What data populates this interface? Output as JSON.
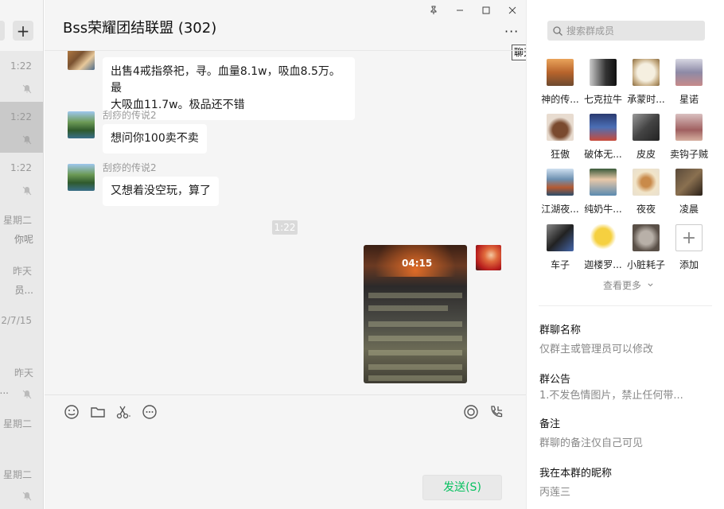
{
  "chat_list": {
    "items": [
      {
        "time": "1:22",
        "muted": true,
        "preview": ""
      },
      {
        "time": "1:22",
        "muted": true,
        "preview": "",
        "selected": true
      },
      {
        "time": "1:22",
        "muted": true,
        "preview": ""
      },
      {
        "time": "星期二",
        "muted": false,
        "preview": "你呢"
      },
      {
        "time": "昨天",
        "muted": false,
        "preview": "员..."
      },
      {
        "time": "2/7/15",
        "muted": false,
        "preview": ""
      },
      {
        "time": "昨天",
        "muted": true,
        "preview": "..."
      },
      {
        "time": "星期二",
        "muted": false,
        "preview": ""
      },
      {
        "time": "星期二",
        "muted": true,
        "preview": ""
      }
    ]
  },
  "chat": {
    "title": "Bss荣耀团结联盟 (302)",
    "tooltip": "聊天",
    "messages": [
      {
        "sender": "",
        "text_line1": "出售4戒指祭祀，寻。血量8.1w，吸血8.5万。最",
        "text_line2": "大吸血11.7w。极品还不错"
      },
      {
        "sender": "刮痧的传说2",
        "text": "想问你100卖不卖"
      },
      {
        "sender": "刮痧的传说2",
        "text": "又想着没空玩，算了"
      }
    ],
    "time_divider": "1:22",
    "image_caption": "04:15",
    "send_button": "发送(S)"
  },
  "panel": {
    "search_placeholder": "搜索群成员",
    "members": [
      {
        "name": "神的传..."
      },
      {
        "name": "七克拉牛"
      },
      {
        "name": "承蒙时..."
      },
      {
        "name": "星诺"
      },
      {
        "name": "狂傲"
      },
      {
        "name": "破体无..."
      },
      {
        "name": "皮皮"
      },
      {
        "name": "卖钩子贼"
      },
      {
        "name": "江湖夜..."
      },
      {
        "name": "纯奶牛..."
      },
      {
        "name": "夜夜"
      },
      {
        "name": "凌晨"
      },
      {
        "name": "车子"
      },
      {
        "name": "迦楼罗..."
      },
      {
        "name": "小脏耗子"
      },
      {
        "name": "添加"
      }
    ],
    "see_more": "查看更多",
    "group_name_label": "群聊名称",
    "group_name_value": "仅群主或管理员可以修改",
    "announcement_label": "群公告",
    "announcement_value": "1.不发色情图片，禁止任何带...",
    "remark_label": "备注",
    "remark_value": "群聊的备注仅自己可见",
    "nickname_label": "我在本群的昵称",
    "nickname_value": "丙莲三"
  }
}
